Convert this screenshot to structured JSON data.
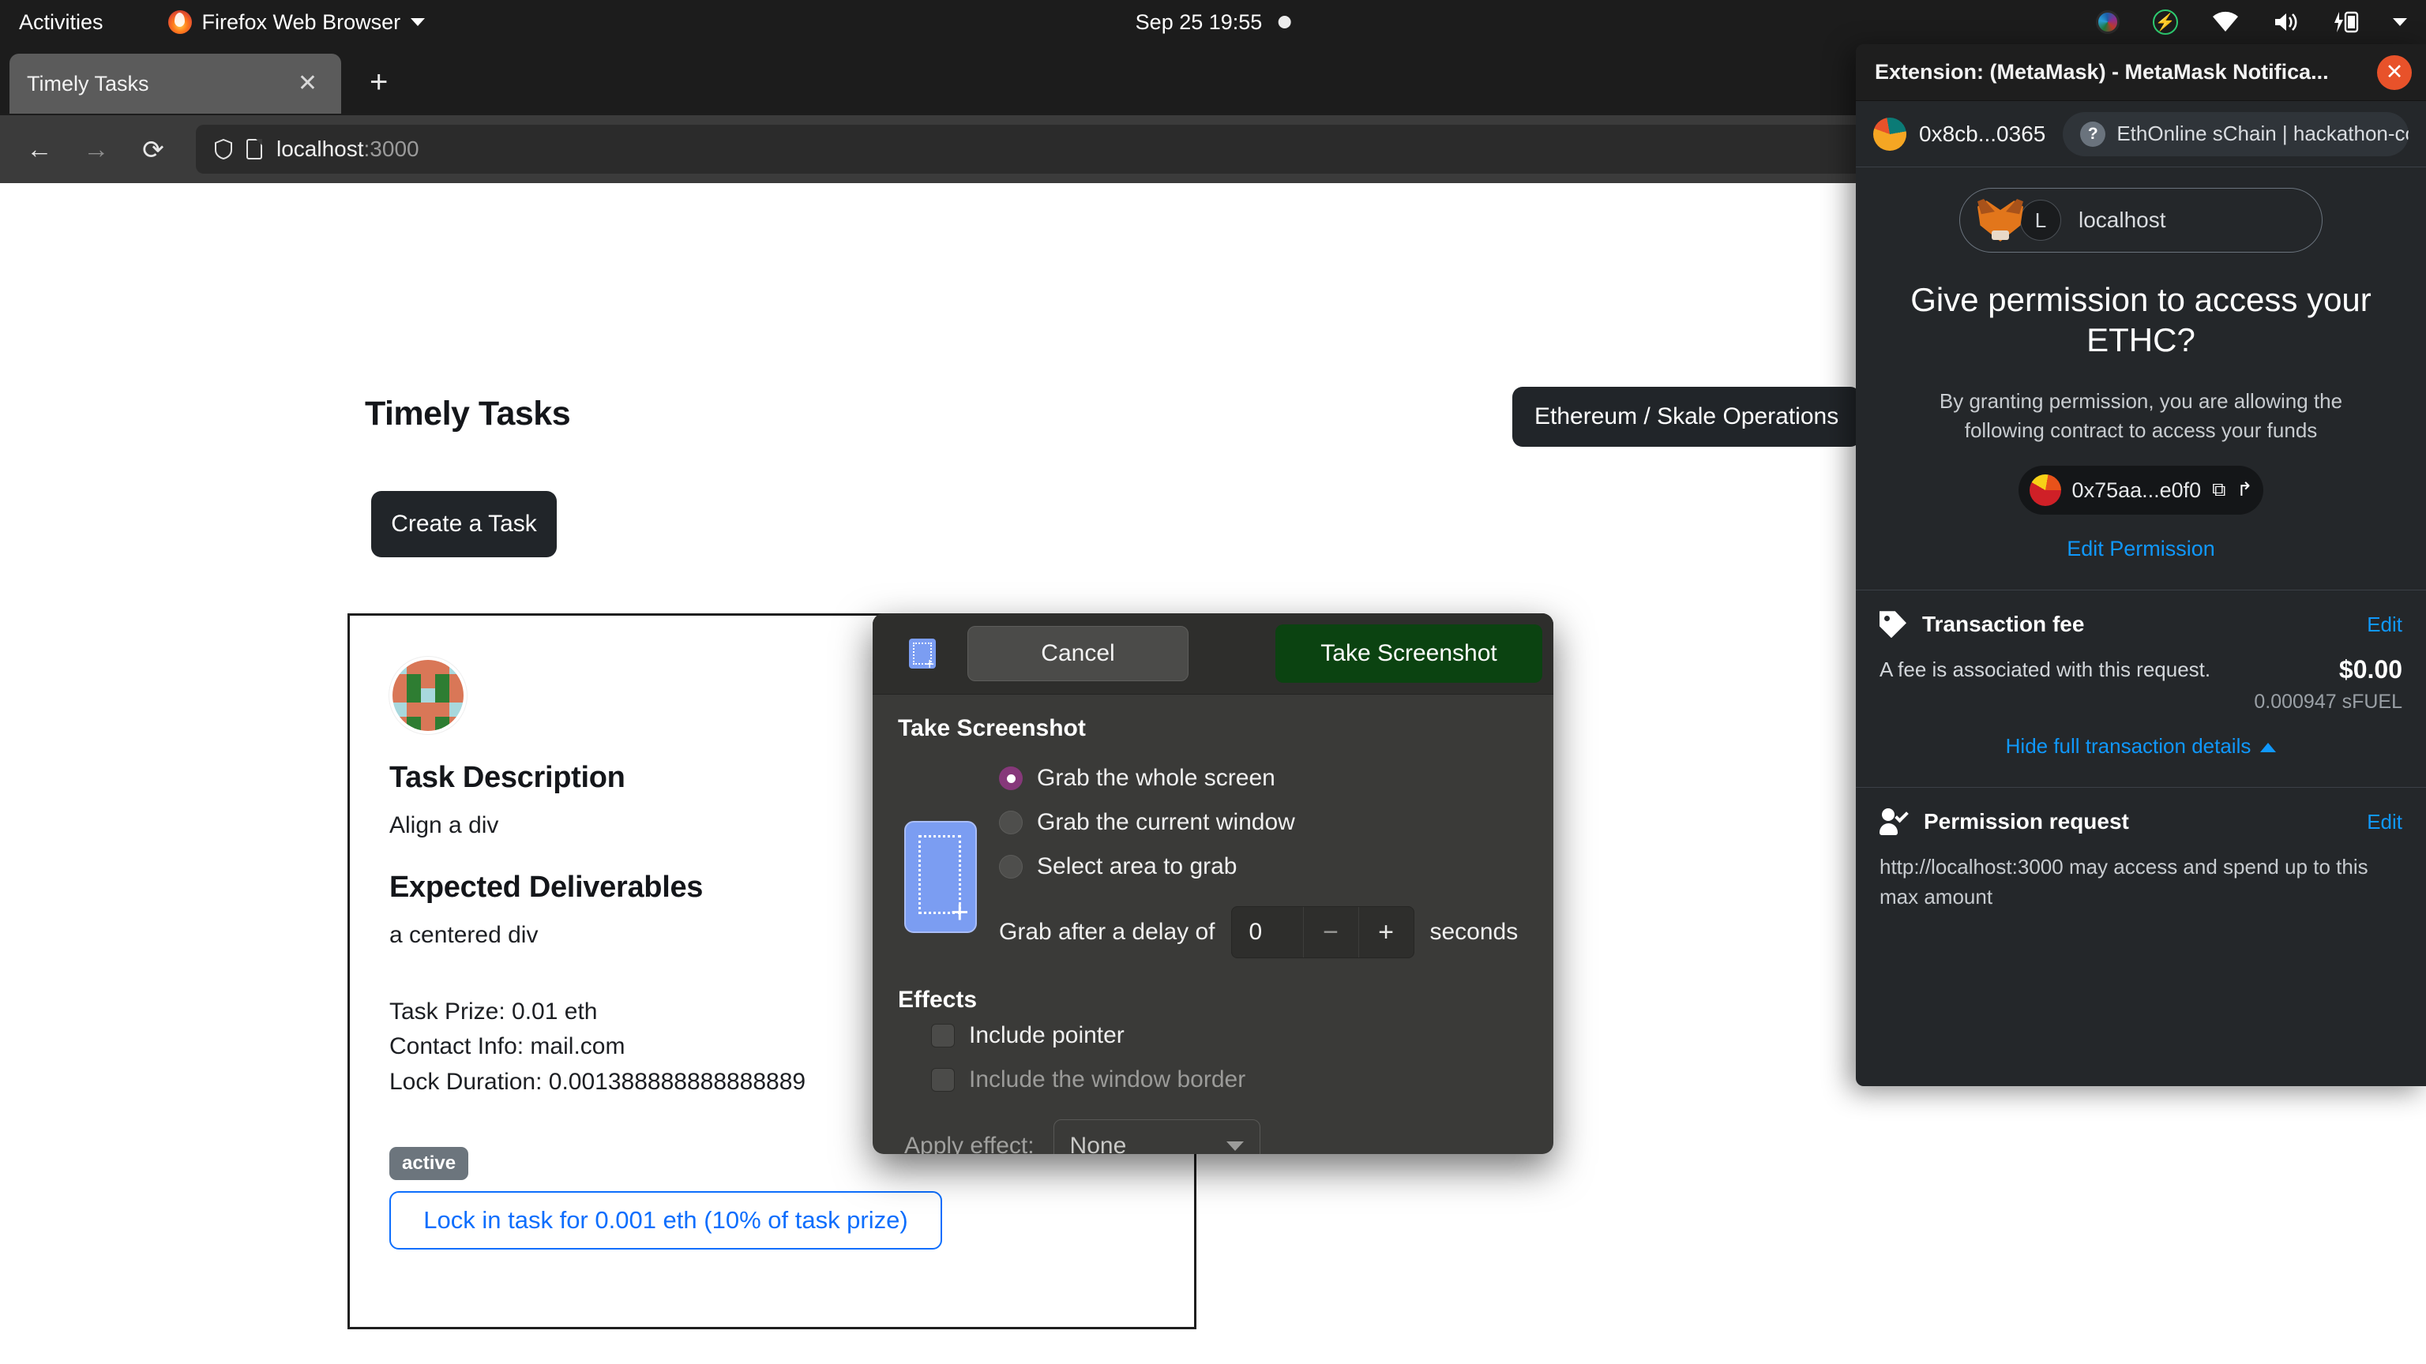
{
  "gnome": {
    "activities": "Activities",
    "app_name": "Firefox Web Browser",
    "clock": "Sep 25  19:55",
    "icons": [
      "camera-icon",
      "bolt-icon",
      "wifi-icon",
      "volume-icon",
      "battery-icon",
      "chevron-down-icon"
    ]
  },
  "firefox": {
    "tab_title": "Timely Tasks",
    "tab_close": "✕",
    "new_tab": "+",
    "back": "←",
    "forward": "→",
    "reload": "⟳",
    "url_host": "localhost",
    "url_port": ":3000"
  },
  "page": {
    "title": "Timely Tasks",
    "chain_button": "Ethereum / Skale Operations",
    "create_button": "Create a Task",
    "card": {
      "description_heading": "Task Description",
      "description_text": "Align a div",
      "deliverables_heading": "Expected Deliverables",
      "deliverables_text": "a centered div",
      "prize": "Task Prize: 0.01 eth",
      "contact": "Contact Info: mail.com",
      "lock_duration": "Lock Duration: 0.001388888888888889",
      "status_badge": "active",
      "lock_button": "Lock in task for 0.001 eth (10% of task prize)"
    }
  },
  "screenshot_dialog": {
    "cancel_label": "Cancel",
    "take_label": "Take Screenshot",
    "section_title": "Take Screenshot",
    "radios": [
      {
        "label": "Grab the whole screen",
        "selected": true
      },
      {
        "label": "Grab the current window",
        "selected": false
      },
      {
        "label": "Select area to grab",
        "selected": false
      }
    ],
    "delay_prefix": "Grab after a delay of",
    "delay_value": "0",
    "delay_minus": "−",
    "delay_plus": "+",
    "delay_suffix": "seconds",
    "effects_title": "Effects",
    "include_pointer": "Include pointer",
    "include_border": "Include the window border",
    "apply_effect_label": "Apply effect:",
    "apply_effect_value": "None"
  },
  "metamask": {
    "window_title": "Extension: (MetaMask) - MetaMask Notifica...",
    "close": "✕",
    "account": "0x8cb...0365",
    "network_help": "?",
    "network": "EthOnline sChain | hackathon-comp",
    "origin_avatar_letter": "L",
    "origin": "localhost",
    "heading": "Give permission to access your ETHC?",
    "subtext": "By granting permission, you are allowing the following contract to access your funds",
    "contract_address": "0x75aa...e0f0",
    "copy_icon": "⧉",
    "share_icon": "↱",
    "edit_permission": "Edit Permission",
    "fee": {
      "title": "Transaction fee",
      "edit": "Edit",
      "text": "A fee is associated with this request.",
      "usd": "$0.00",
      "native": "0.000947 sFUEL",
      "hide_details": "Hide full transaction details"
    },
    "permission": {
      "title": "Permission request",
      "edit": "Edit",
      "text": "http://localhost:3000 may access and spend up to this max amount"
    }
  },
  "colors": {
    "accent_blue": "#1098fc",
    "link_blue": "#0d6efd",
    "dark": "#212529",
    "green": "#0b4311",
    "orange": "#e8522a"
  },
  "identicon": {
    "palette": {
      "a": "#d97757",
      "b": "#2e7d32",
      "c": "#a8d8dd"
    },
    "cells": [
      "c",
      "a",
      "a",
      "a",
      "c",
      "a",
      "b",
      "a",
      "b",
      "a",
      "a",
      "b",
      "c",
      "b",
      "a",
      "c",
      "a",
      "a",
      "a",
      "c",
      "a",
      "b",
      "a",
      "b",
      "a"
    ]
  }
}
